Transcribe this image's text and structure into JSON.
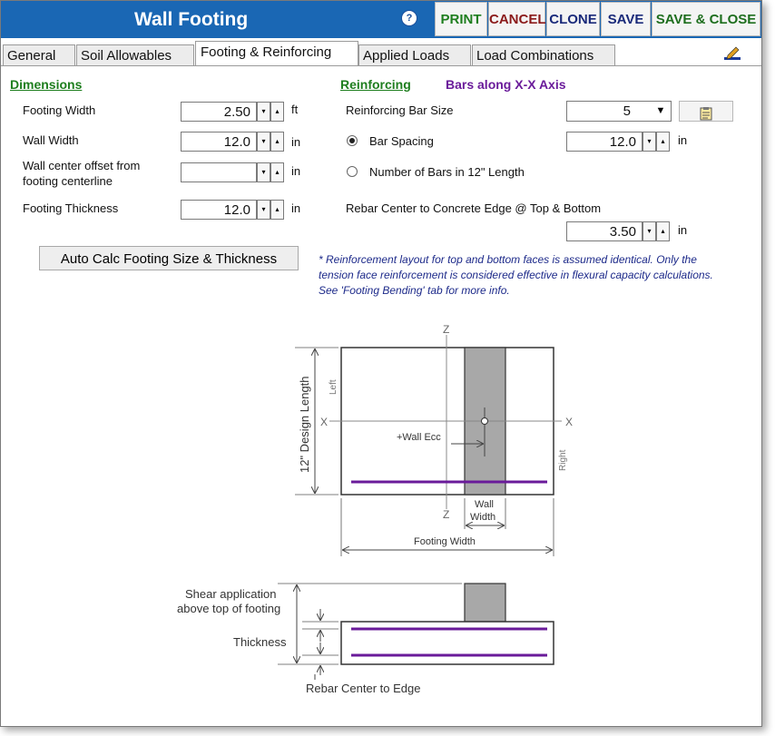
{
  "window": {
    "title": "Wall Footing",
    "help_icon": "?"
  },
  "toolbar": {
    "print": "PRINT",
    "cancel": "CANCEL",
    "clone": "CLONE",
    "save": "SAVE",
    "save_close": "SAVE & CLOSE",
    "colors": {
      "print": "#1e7e1e",
      "cancel": "#8b1a1a",
      "clone": "#1a2a7a",
      "save": "#1a2a7a",
      "save_close": "#1e6e1e"
    }
  },
  "tabs": [
    "General",
    "Soil Allowables",
    "Footing & Reinforcing",
    "Applied Loads",
    "Load Combinations"
  ],
  "active_tab": "Footing & Reinforcing",
  "dimensions": {
    "heading": "Dimensions",
    "footing_width": {
      "label": "Footing Width",
      "value": "2.50",
      "unit": "ft"
    },
    "wall_width": {
      "label": "Wall Width",
      "value": "12.0",
      "unit": "in"
    },
    "wall_offset": {
      "label_line1": "Wall center offset from",
      "label_line2": "footing centerline",
      "value": "",
      "unit": "in"
    },
    "footing_thickness": {
      "label": "Footing Thickness",
      "value": "12.0",
      "unit": "in"
    }
  },
  "reinforcing": {
    "heading": "Reinforcing",
    "subheading": "Bars along X-X Axis",
    "bar_size": {
      "label": "Reinforcing Bar Size",
      "value": "5"
    },
    "bar_spacing": {
      "label": "Bar Spacing",
      "value": "12.0",
      "unit": "in",
      "selected": true
    },
    "num_bars": {
      "label": "Number of Bars in 12\" Length",
      "selected": false
    },
    "rebar_edge": {
      "label": "Rebar Center to Concrete Edge @ Top & Bottom",
      "value": "3.50",
      "unit": "in"
    }
  },
  "auto_calc_button": "Auto Calc Footing Size & Thickness",
  "note": "* Reinforcement layout for top and bottom faces is assumed identical. Only the tension face reinforcement is considered effective in flexural capacity calculations. See 'Footing Bending' tab for more info.",
  "diagram": {
    "plan": {
      "z_top": "Z",
      "z_bottom": "Z",
      "x_left": "X",
      "x_right": "X",
      "left": "Left",
      "right": "Right",
      "design_length": "12\" Design Length",
      "wall_ecc": "+Wall Ecc",
      "wall_width_1": "Wall",
      "wall_width_2": "Width",
      "footing_width": "Footing Width"
    },
    "section": {
      "shear_1": "Shear application",
      "shear_2": "above top of footing",
      "thickness": "Thickness",
      "rebar_edge": "Rebar Center to Edge"
    },
    "colors": {
      "rebar": "#6a1b9a",
      "wall": "#a8a8a8",
      "dim": "#444444"
    }
  }
}
